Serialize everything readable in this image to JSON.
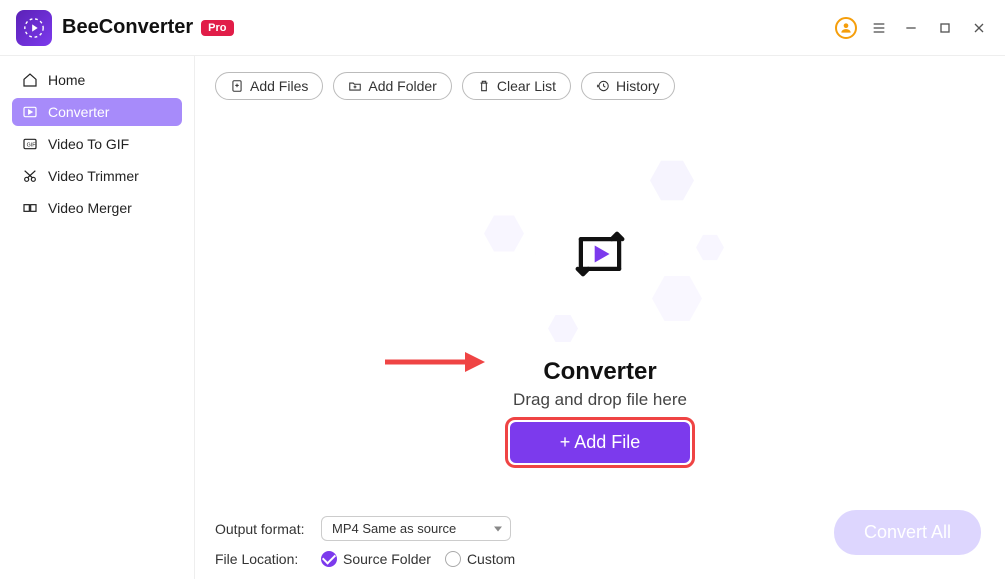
{
  "app": {
    "title": "BeeConverter",
    "badge": "Pro"
  },
  "sidebar": {
    "items": [
      {
        "label": "Home"
      },
      {
        "label": "Converter"
      },
      {
        "label": "Video To GIF"
      },
      {
        "label": "Video Trimmer"
      },
      {
        "label": "Video Merger"
      }
    ]
  },
  "toolbar": {
    "add_files": "Add Files",
    "add_folder": "Add Folder",
    "clear_list": "Clear List",
    "history": "History"
  },
  "drop": {
    "title": "Converter",
    "subtitle": "Drag and drop file here",
    "add_file_label": "+ Add File"
  },
  "footer": {
    "output_format_label": "Output format:",
    "output_format_value": "MP4 Same as source",
    "file_location_label": "File Location:",
    "source_folder_label": "Source Folder",
    "custom_label": "Custom",
    "convert_all_label": "Convert All"
  }
}
